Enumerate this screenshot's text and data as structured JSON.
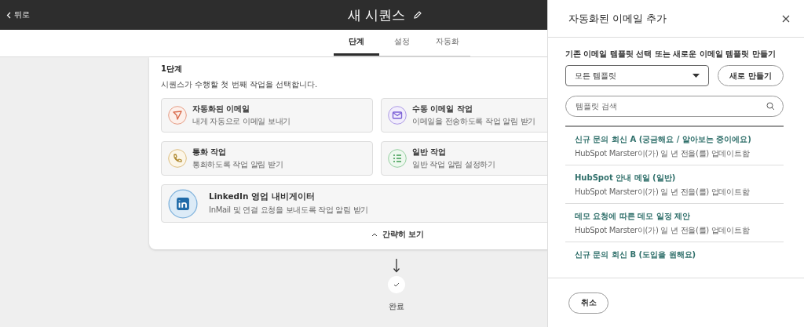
{
  "header": {
    "back": "뒤로",
    "title": "새 시퀀스"
  },
  "tabs": [
    {
      "label": "단계",
      "selected": true
    },
    {
      "label": "설정",
      "selected": false
    },
    {
      "label": "자동화",
      "selected": false
    }
  ],
  "step": {
    "title": "1단계",
    "description": "시퀀스가 수행할 첫 번째 작업을 선택합니다.",
    "options": [
      {
        "kind": "send",
        "title": "자동화된 이메일",
        "subtitle": "내게 자동으로 이메일 보내기"
      },
      {
        "kind": "mail",
        "title": "수동 이메일 작업",
        "subtitle": "이메일을 전송하도록 작업 알림 받기"
      },
      {
        "kind": "phone",
        "title": "통화 작업",
        "subtitle": "통화하도록 작업 알림 받기"
      },
      {
        "kind": "list",
        "title": "일반 작업",
        "subtitle": "일반 작업 알림 설정하기"
      },
      {
        "kind": "linkedin",
        "title": "LinkedIn 영업 내비게이터",
        "subtitle": "InMail 및 연결 요청을 보내도록 작업 알림 받기"
      }
    ],
    "collapse": "간략히 보기"
  },
  "end": {
    "label": "완료"
  },
  "panel": {
    "title": "자동화된 이메일 추가",
    "prompt": "기존 이메일 템플릿 선택 또는 새로운 이메일 템플릿 만들기",
    "dropdown": "모든 템플릿",
    "create": "새로 만들기",
    "search_placeholder": "템플릿 검색",
    "templates": [
      {
        "title": "신규 문의 회신 A (궁금해요 / 알아보는 중이에요)",
        "subtitle": "HubSpot Marster이(가) 일 년 전을(를) 업데이트함"
      },
      {
        "title": "HubSpot 안내 메일 (일반)",
        "subtitle": "HubSpot Marster이(가) 일 년 전을(를) 업데이트함"
      },
      {
        "title": "데모 요청에 따른 데모 일정 제안",
        "subtitle": "HubSpot Marster이(가) 일 년 전을(를) 업데이트함"
      },
      {
        "title": "신규 문의 회신 B (도입을 원해요)"
      }
    ],
    "cancel": "취소"
  }
}
